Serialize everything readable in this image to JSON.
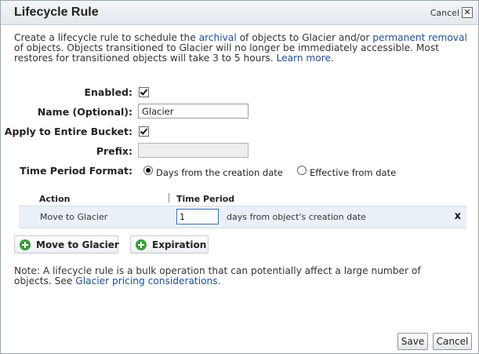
{
  "dialog": {
    "title": "Lifecycle Rule",
    "title_cancel": "Cancel",
    "close_glyph": "✕"
  },
  "intro": {
    "t1": "Create a lifecycle rule to schedule the ",
    "link_archival": "archival",
    "t2": " of objects to Glacier and/or ",
    "link_removal": "permanent removal",
    "t3": " of objects. Objects transitioned to Glacier will no longer be immediately accessible. Most restores for transitioned objects will take 3 to 5 hours. ",
    "link_learn": "Learn more",
    "t4": "."
  },
  "form": {
    "enabled_label": "Enabled:",
    "enabled_checked": true,
    "name_label": "Name (Optional):",
    "name_value": "Glacier",
    "entire_bucket_label": "Apply to Entire Bucket:",
    "entire_bucket_checked": true,
    "prefix_label": "Prefix:",
    "prefix_value": "",
    "time_period_label": "Time Period Format:",
    "time_period_options": [
      {
        "label": "Days from the creation date",
        "selected": true
      },
      {
        "label": "Effective from date",
        "selected": false
      }
    ]
  },
  "table": {
    "headers": [
      "Action",
      "Time Period"
    ],
    "rows": [
      {
        "action": "Move to Glacier",
        "period_value": "1",
        "suffix": "days from object's creation date",
        "remove": "x"
      }
    ]
  },
  "add_buttons": {
    "glacier": "Move to Glacier",
    "expiration": "Expiration"
  },
  "note": {
    "t1": "Note: A lifecycle rule is a bulk operation that can potentially affect a large number of objects. See ",
    "link": "Glacier pricing considerations",
    "t2": "."
  },
  "footer": {
    "save": "Save",
    "cancel": "Cancel"
  },
  "colors": {
    "link": "#1f4e9a",
    "row_highlight": "#e9f0f7",
    "add_icon": "#3e9b3e"
  }
}
